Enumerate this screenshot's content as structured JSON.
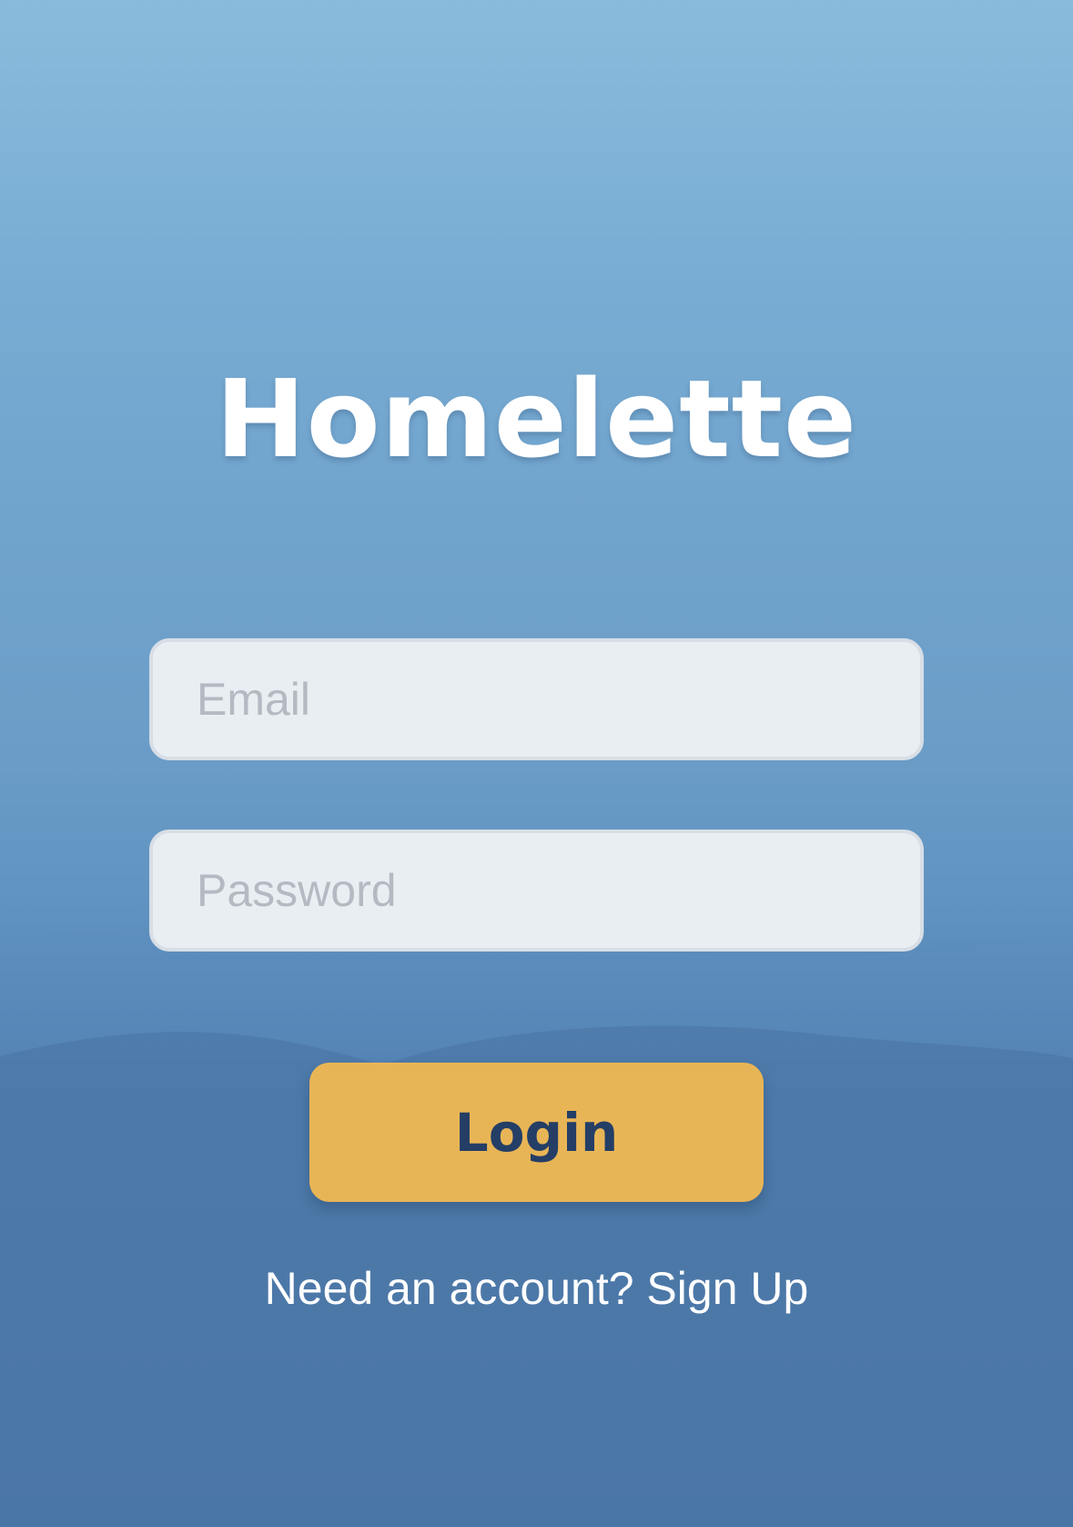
{
  "app": {
    "title": "Homelette"
  },
  "form": {
    "email_placeholder": "Email",
    "password_placeholder": "Password",
    "login_label": "Login"
  },
  "footer": {
    "signup_text": "Need an account? Sign Up"
  },
  "colors": {
    "button_bg": "#e8b556",
    "button_text": "#243e66",
    "field_bg": "#e9eef3",
    "title": "#ffffff"
  }
}
